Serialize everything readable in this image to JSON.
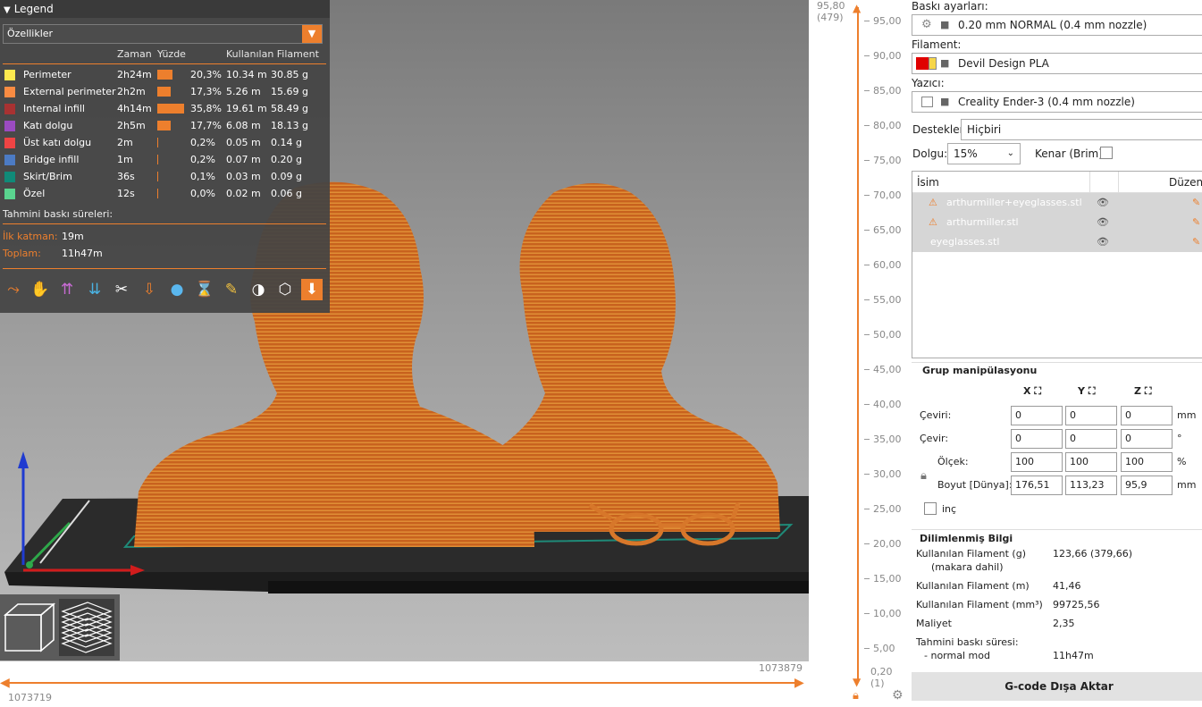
{
  "legend": {
    "title": "Legend",
    "view_type": "Özellikler",
    "columns": {
      "time": "Zaman",
      "percent": "Yüzde",
      "filament": "Kullanılan Filament"
    },
    "rows": [
      {
        "name": "Perimeter",
        "time": "2h24m",
        "percent": "20,3%",
        "length": "10.34 m",
        "weight": "30.85 g",
        "color": "#fce94f",
        "share": 0.203
      },
      {
        "name": "External perimeter",
        "time": "2h2m",
        "percent": "17,3%",
        "length": "5.26 m",
        "weight": "15.69 g",
        "color": "#f98b42",
        "share": 0.173
      },
      {
        "name": "Internal infill",
        "time": "4h14m",
        "percent": "35,8%",
        "length": "19.61 m",
        "weight": "58.49 g",
        "color": "#a83232",
        "share": 0.358
      },
      {
        "name": "Katı dolgu",
        "time": "2h5m",
        "percent": "17,7%",
        "length": "6.08 m",
        "weight": "18.13 g",
        "color": "#9a4bc1",
        "share": 0.177
      },
      {
        "name": "Üst katı dolgu",
        "time": "2m",
        "percent": "0,2%",
        "length": "0.05 m",
        "weight": "0.14 g",
        "color": "#ef4444",
        "share": 0.002
      },
      {
        "name": "Bridge infill",
        "time": "1m",
        "percent": "0,2%",
        "length": "0.07 m",
        "weight": "0.20 g",
        "color": "#4c7bc4",
        "share": 0.002
      },
      {
        "name": "Skirt/Brim",
        "time": "36s",
        "percent": "0,1%",
        "length": "0.03 m",
        "weight": "0.09 g",
        "color": "#108a78",
        "share": 0.001
      },
      {
        "name": "Özel",
        "time": "12s",
        "percent": "0,0%",
        "length": "0.02 m",
        "weight": "0.06 g",
        "color": "#5ad48f",
        "share": 0.0
      }
    ],
    "estimated_label": "Tahmini baskı süreleri:",
    "first_layer_label": "İlk katman:",
    "first_layer_value": "19m",
    "total_label": "Toplam:",
    "total_value": "11h47m"
  },
  "hslider": {
    "right_label": "1073879",
    "left_label": "1073719"
  },
  "vslider": {
    "top_label": "95,80",
    "top_sub": "(479)",
    "bottom_label": "0,20",
    "bottom_sub": "(1)",
    "ticks": [
      "95,00",
      "90,00",
      "85,00",
      "80,00",
      "75,00",
      "70,00",
      "65,00",
      "60,00",
      "55,00",
      "50,00",
      "45,00",
      "40,00",
      "35,00",
      "30,00",
      "25,00",
      "20,00",
      "15,00",
      "10,00",
      "5,00"
    ]
  },
  "sidebar": {
    "print_settings_label": "Baskı ayarları:",
    "print_settings_value": "0.20 mm NORMAL (0.4 mm nozzle)",
    "filament_label": "Filament:",
    "filament_value": "Devil Design PLA",
    "printer_label": "Yazıcı:",
    "printer_value": "Creality Ender-3 (0.4 mm nozzle)",
    "supports_label": "Destekler:",
    "supports_value": "Hiçbiri",
    "infill_label": "Dolgu:",
    "infill_value": "15%",
    "brim_label": "Kenar (Brim):",
    "list_header_name": "İsim",
    "list_header_edit": "Düzenl",
    "objects": [
      "arthurmiller+eyeglasses.stl",
      "arthurmiller.stl",
      "eyeglasses.stl"
    ],
    "group_title": "Grup manipülasyonu",
    "axes": [
      "X",
      "Y",
      "Z"
    ],
    "rows": [
      {
        "label": "Çeviri:",
        "values": [
          "0",
          "0",
          "0"
        ],
        "unit": "mm"
      },
      {
        "label": "Çevir:",
        "values": [
          "0",
          "0",
          "0"
        ],
        "unit": "°"
      },
      {
        "label": "Ölçek:",
        "values": [
          "100",
          "100",
          "100"
        ],
        "unit": "%"
      },
      {
        "label": "Boyut [Dünya]:",
        "values": [
          "176,51",
          "113,23",
          "95,9"
        ],
        "unit": "mm"
      }
    ],
    "inch_label": "inç",
    "sliced_title": "Dilimlenmiş Bilgi",
    "sliced": [
      {
        "k": "Kullanılan Filament (g)",
        "k2": "(makara dahil)",
        "v": "123,66 (379,66)"
      },
      {
        "k": "Kullanılan Filament (m)",
        "v": "41,46"
      },
      {
        "k": "Kullanılan Filament (mm³)",
        "v": "99725,56"
      },
      {
        "k": "Maliyet",
        "v": "2,35"
      },
      {
        "k": "Tahmini baskı süresi:",
        "v": ""
      },
      {
        "k": "- normal mod",
        "v": "11h47m"
      }
    ],
    "export_label": "G-code Dışa Aktar"
  },
  "colors": {
    "accent": "#ed7f2d",
    "model": "#c8621e"
  }
}
